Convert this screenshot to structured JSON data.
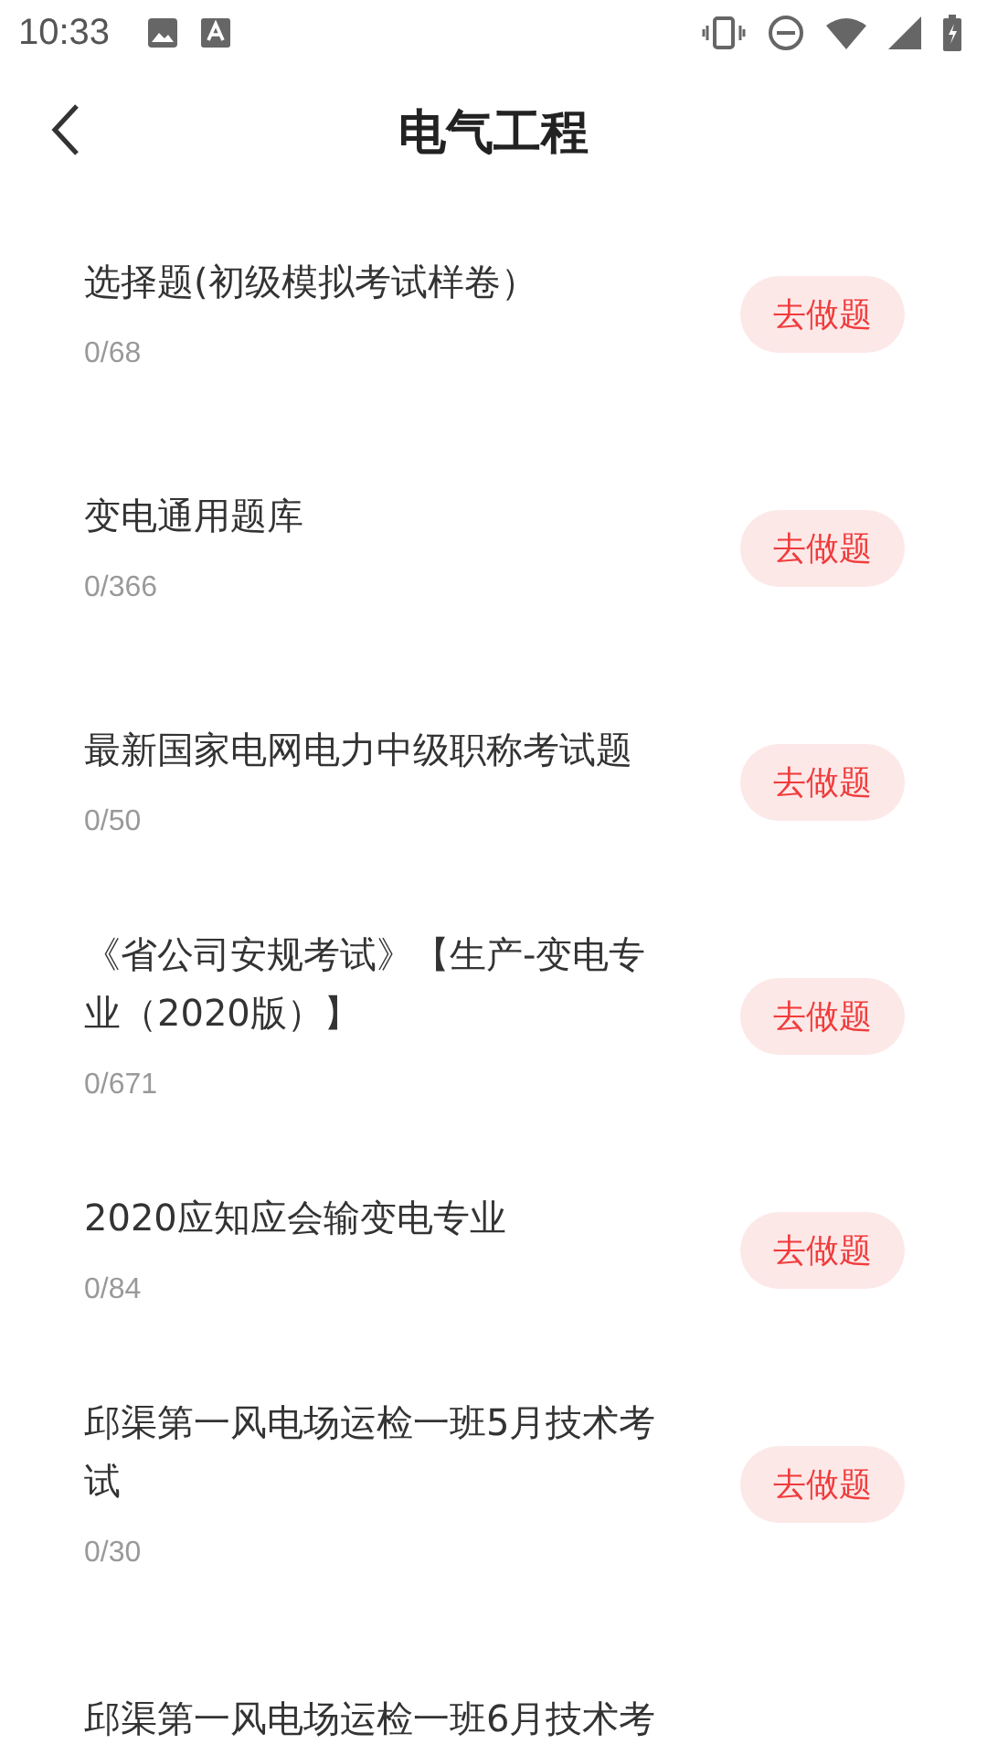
{
  "status_bar": {
    "time": "10:33"
  },
  "header": {
    "title": "电气工程"
  },
  "items": [
    {
      "title": "选择题(初级模拟考试样卷）",
      "progress": "0/68",
      "action": "去做题"
    },
    {
      "title": "变电通用题库",
      "progress": "0/366",
      "action": "去做题"
    },
    {
      "title": "最新国家电网电力中级职称考试题",
      "progress": "0/50",
      "action": "去做题"
    },
    {
      "title": "《省公司安规考试》【生产-变电专业（2020版）】",
      "progress": "0/671",
      "action": "去做题"
    },
    {
      "title": "2020应知应会输变电专业",
      "progress": "0/84",
      "action": "去做题"
    },
    {
      "title": "邱渠第一风电场运检一班5月技术考试",
      "progress": "0/30",
      "action": "去做题"
    },
    {
      "title": "邱渠第一风电场运检一班6月技术考"
    }
  ]
}
